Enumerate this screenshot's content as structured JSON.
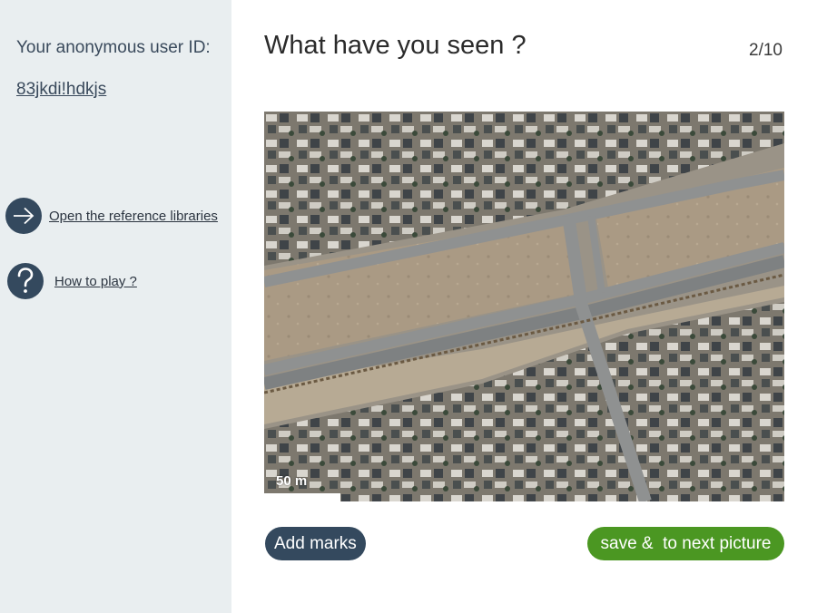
{
  "sidebar": {
    "user_id_label": "Your anonymous user ID:",
    "user_id_value": "83jkdi!hdkjs",
    "links": [
      {
        "label": "Open the reference libraries",
        "icon": "arrow-right-icon"
      },
      {
        "label": "How to play ?",
        "icon": "question-icon"
      }
    ]
  },
  "main": {
    "title": "What have you seen ?",
    "counter": "2/10",
    "image": {
      "scale_label": "50 m"
    },
    "buttons": {
      "add_marks": "Add marks",
      "save_next": "save &  to next picture"
    }
  },
  "colors": {
    "sidebar_bg": "#e9eef0",
    "dark_accent": "#34495e",
    "green_accent": "#4b9722"
  }
}
